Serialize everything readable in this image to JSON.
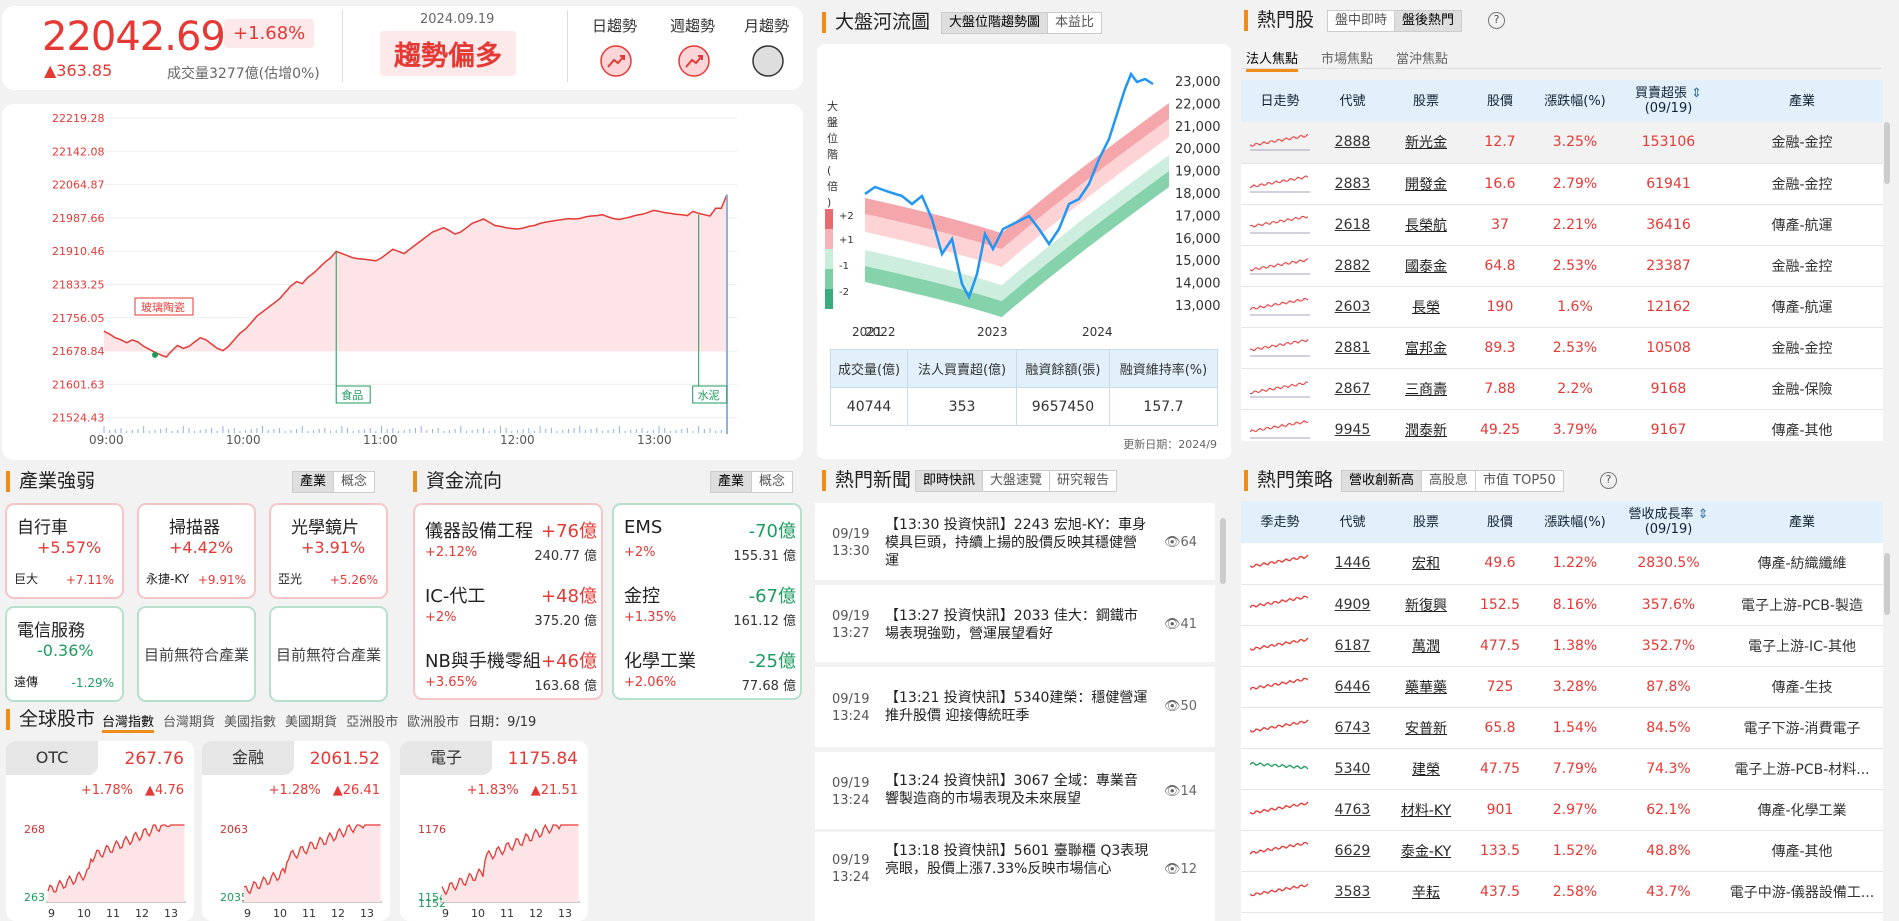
{
  "index": {
    "value": "22042.69",
    "pct": "+1.68%",
    "change": "▲363.85",
    "volume": "成交量3277億(估增0%)",
    "date": "2024.09.19",
    "trend": "趨勢偏多",
    "trend_labels": [
      "日趨勢",
      "週趨勢",
      "月趨勢"
    ]
  },
  "intraday": {
    "yticks": [
      "22219.28",
      "22142.08",
      "22064.87",
      "21987.66",
      "21910.46",
      "21833.25",
      "21756.05",
      "21678.84",
      "21601.63",
      "21524.43"
    ],
    "xticks": [
      "09:00",
      "10:00",
      "11:00",
      "12:00",
      "13:00"
    ],
    "labels": [
      "玻璃陶瓷",
      "食品",
      "水泥"
    ],
    "series": [
      21725,
      21718,
      21710,
      21705,
      21698,
      21705,
      21700,
      21690,
      21683,
      21676,
      21670,
      21665,
      21680,
      21692,
      21685,
      21690,
      21700,
      21710,
      21705,
      21695,
      21685,
      21680,
      21690,
      21705,
      21720,
      21730,
      21745,
      21760,
      21770,
      21780,
      21790,
      21800,
      21815,
      21830,
      21840,
      21835,
      21850,
      21860,
      21872,
      21885,
      21895,
      21910,
      21905,
      21900,
      21895,
      21893,
      21892,
      21890,
      21888,
      21895,
      21905,
      21915,
      21910,
      21905,
      21915,
      21925,
      21935,
      21945,
      21955,
      21960,
      21965,
      21958,
      21950,
      21955,
      21965,
      21975,
      21980,
      21985,
      21978,
      21970,
      21968,
      21965,
      21963,
      21962,
      21964,
      21968,
      21970,
      21975,
      21978,
      21980,
      21982,
      21984,
      21986,
      21985,
      21986,
      21990,
      21992,
      21993,
      21995,
      21990,
      21986,
      21984,
      21987,
      21990,
      21994,
      21996,
      22000,
      22005,
      22003,
      22000,
      21998,
      21996,
      21995,
      21993,
      22003,
      21998,
      21995,
      21992,
      22010,
      22010,
      22042
    ]
  },
  "river": {
    "title": "大盤河流圖",
    "tabs": [
      "大盤位階趨勢圖",
      "本益比"
    ],
    "ylabel": "大盤位階(倍)",
    "yticks": [
      "23,000",
      "22,000",
      "21,000",
      "20,000",
      "19,000",
      "18,000",
      "17,000",
      "16,000",
      "15,000",
      "14,000",
      "13,000"
    ],
    "xticks": [
      "2021",
      "2022",
      "2023",
      "2024"
    ],
    "band_labels": [
      "+2",
      "+1",
      "-1",
      "-2"
    ],
    "stats_headers": [
      "成交量(億)",
      "法人買賣超(億)",
      "融資餘額(張)",
      "融資維持率(%)"
    ],
    "stats_values": [
      "40744",
      "353",
      "9657450",
      "157.7"
    ],
    "update": "更新日期：2024/9"
  },
  "hot": {
    "title": "熱門股",
    "tabs": [
      "盤中即時",
      "盤後熱門"
    ],
    "subtabs": [
      "法人焦點",
      "市場焦點",
      "當沖焦點"
    ],
    "headers": [
      "日走勢",
      "代號",
      "股票",
      "股價",
      "漲跌幅(%)",
      "買賣超張",
      "(09/19)",
      "產業"
    ],
    "rows": [
      {
        "code": "2888",
        "name": "新光金",
        "price": "12.7",
        "pct": "3.25%",
        "vol": "153106",
        "ind": "金融-金控"
      },
      {
        "code": "2883",
        "name": "開發金",
        "price": "16.6",
        "pct": "2.79%",
        "vol": "61941",
        "ind": "金融-金控"
      },
      {
        "code": "2618",
        "name": "長榮航",
        "price": "37",
        "pct": "2.21%",
        "vol": "36416",
        "ind": "傳產-航運"
      },
      {
        "code": "2882",
        "name": "國泰金",
        "price": "64.8",
        "pct": "2.53%",
        "vol": "23387",
        "ind": "金融-金控"
      },
      {
        "code": "2603",
        "name": "長榮",
        "price": "190",
        "pct": "1.6%",
        "vol": "12162",
        "ind": "傳產-航運"
      },
      {
        "code": "2881",
        "name": "富邦金",
        "price": "89.3",
        "pct": "2.53%",
        "vol": "10508",
        "ind": "金融-金控"
      },
      {
        "code": "2867",
        "name": "三商壽",
        "price": "7.88",
        "pct": "2.2%",
        "vol": "9168",
        "ind": "金融-保險"
      },
      {
        "code": "9945",
        "name": "潤泰新",
        "price": "49.25",
        "pct": "3.79%",
        "vol": "9167",
        "ind": "傳產-其他"
      }
    ]
  },
  "industry": {
    "title": "產業強弱",
    "tabs": [
      "產業",
      "概念"
    ],
    "cards": [
      {
        "name": "自行車",
        "pct": "+5.57%",
        "stock": "巨大",
        "spct": "+7.11%"
      },
      {
        "name": "掃描器",
        "pct": "+4.42%",
        "stock": "永捷-KY",
        "spct": "+9.91%"
      },
      {
        "name": "光學鏡片",
        "pct": "+3.91%",
        "stock": "亞光",
        "spct": "+5.26%"
      },
      {
        "name": "電信服務",
        "pct": "-0.36%",
        "stock": "遠傳",
        "spct": "-1.29%"
      }
    ],
    "none": "目前無符合產業"
  },
  "flow": {
    "title": "資金流向",
    "tabs": [
      "產業",
      "概念"
    ],
    "in": [
      {
        "name": "儀器設備工程",
        "v": "+76億",
        "pct": "+2.12%",
        "amt": "240.77 億"
      },
      {
        "name": "IC-代工",
        "v": "+48億",
        "pct": "+2%",
        "amt": "375.20 億"
      },
      {
        "name": "NB與手機零組件",
        "v": "+46億",
        "pct": "+3.65%",
        "amt": "163.68 億"
      }
    ],
    "out": [
      {
        "name": "EMS",
        "v": "-70億",
        "pct": "+2%",
        "amt": "155.31 億"
      },
      {
        "name": "金控",
        "v": "-67億",
        "pct": "+1.35%",
        "amt": "161.12 億"
      },
      {
        "name": "化學工業",
        "v": "-25億",
        "pct": "+2.06%",
        "amt": "77.68 億"
      }
    ]
  },
  "news": {
    "title": "熱門新聞",
    "tabs": [
      "即時快訊",
      "大盤速覽",
      "研究報告"
    ],
    "items": [
      {
        "d": "09/19",
        "t": "13:30",
        "text": "【13:30 投資快訊】2243 宏旭-KY：車身模具巨頭，持續上揚的股價反映其穩健營運",
        "views": "64"
      },
      {
        "d": "09/19",
        "t": "13:27",
        "text": "【13:27 投資快訊】2033 佳大：鋼鐵市場表現強勁，營運展望看好",
        "views": "41"
      },
      {
        "d": "09/19",
        "t": "13:24",
        "text": "【13:21 投資快訊】5340建榮：穩健營運推升股價 迎接傳統旺季",
        "views": "50"
      },
      {
        "d": "09/19",
        "t": "13:24",
        "text": "【13:24 投資快訊】3067 全域：專業音響製造商的市場表現及未來展望",
        "views": "14"
      },
      {
        "d": "09/19",
        "t": "13:24",
        "text": "【13:18 投資快訊】5601 臺聯櫃 Q3表現亮眼，股價上漲7.33%反映市場信心",
        "views": "12"
      }
    ]
  },
  "strategy": {
    "title": "熱門策略",
    "tabs": [
      "營收創新高",
      "高股息",
      "市值 TOP50"
    ],
    "headers": [
      "季走勢",
      "代號",
      "股票",
      "股價",
      "漲跌幅(%)",
      "營收成長率",
      "(09/19)",
      "產業"
    ],
    "rows": [
      {
        "code": "1446",
        "name": "宏和",
        "price": "49.6",
        "pct": "1.22%",
        "g": "2830.5%",
        "ind": "傳產-紡織纖維",
        "dn": false
      },
      {
        "code": "4909",
        "name": "新復興",
        "price": "152.5",
        "pct": "8.16%",
        "g": "357.6%",
        "ind": "電子上游-PCB-製造",
        "dn": false
      },
      {
        "code": "6187",
        "name": "萬潤",
        "price": "477.5",
        "pct": "1.38%",
        "g": "352.7%",
        "ind": "電子上游-IC-其他",
        "dn": false
      },
      {
        "code": "6446",
        "name": "藥華藥",
        "price": "725",
        "pct": "3.28%",
        "g": "87.8%",
        "ind": "傳產-生技",
        "dn": false
      },
      {
        "code": "6743",
        "name": "安普新",
        "price": "65.8",
        "pct": "1.54%",
        "g": "84.5%",
        "ind": "電子下游-消費電子",
        "dn": false
      },
      {
        "code": "5340",
        "name": "建榮",
        "price": "47.75",
        "pct": "7.79%",
        "g": "74.3%",
        "ind": "電子上游-PCB-材料...",
        "dn": true
      },
      {
        "code": "4763",
        "name": "材料-KY",
        "price": "901",
        "pct": "2.97%",
        "g": "62.1%",
        "ind": "傳產-化學工業",
        "dn": false
      },
      {
        "code": "6629",
        "name": "泰金-KY",
        "price": "133.5",
        "pct": "1.52%",
        "g": "48.8%",
        "ind": "傳產-其他",
        "dn": false
      },
      {
        "code": "3583",
        "name": "辛耘",
        "price": "437.5",
        "pct": "2.58%",
        "g": "43.7%",
        "ind": "電子中游-儀器設備工...",
        "dn": false
      }
    ]
  },
  "global": {
    "title": "全球股市",
    "tabs": [
      "台灣指數",
      "台灣期貨",
      "美國指數",
      "美國期貨",
      "亞洲股市",
      "歐洲股市"
    ],
    "date": "日期：9/19",
    "cards": [
      {
        "name": "OTC",
        "price": "267.76",
        "pct": "+1.78%",
        "chg": "▲4.76",
        "yt": [
          "268",
          "263"
        ],
        "ylo": 263,
        "yhi": 268.5
      },
      {
        "name": "金融",
        "price": "2061.52",
        "pct": "+1.28%",
        "chg": "▲26.41",
        "yt": [
          "2063",
          "2035"
        ],
        "ylo": 2035,
        "yhi": 2064
      },
      {
        "name": "電子",
        "price": "1175.84",
        "pct": "+1.83%",
        "chg": "▲21.51",
        "yt": [
          "1176",
          "1154",
          "1152"
        ],
        "ylo": 1152,
        "yhi": 1177
      }
    ],
    "xt": [
      "9",
      "10",
      "11",
      "12",
      "13"
    ]
  }
}
